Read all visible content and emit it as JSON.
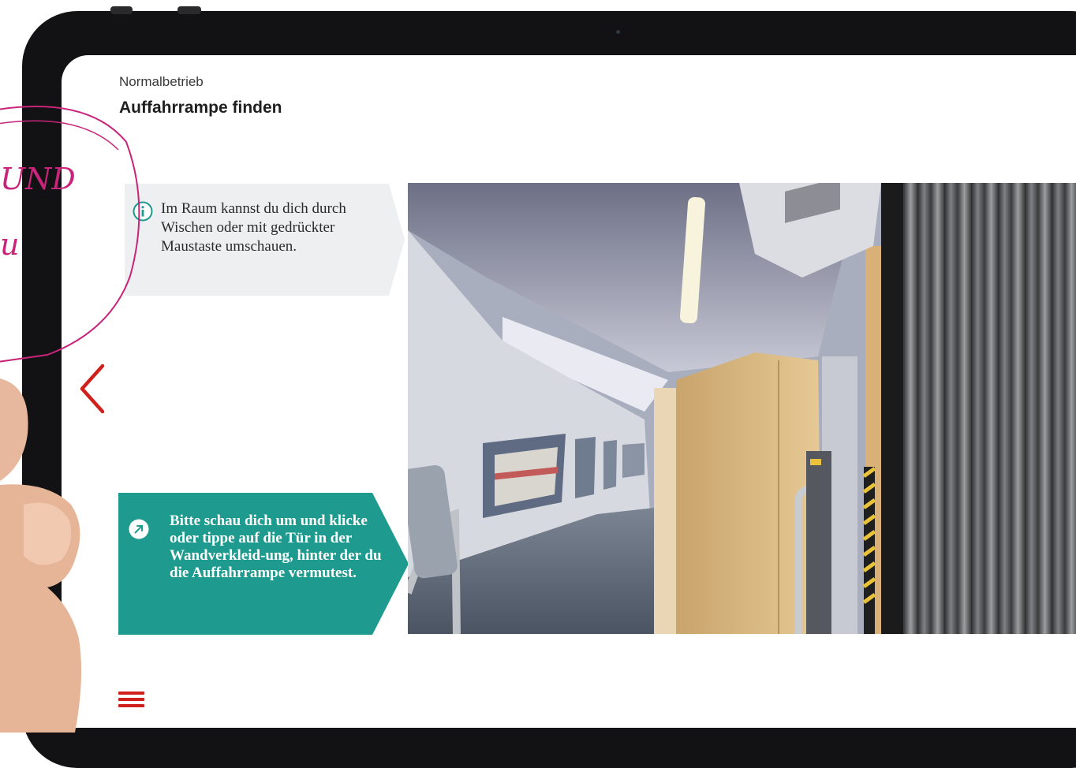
{
  "breadcrumb": "Normalbetrieb",
  "title": "Auffahrrampe finden",
  "info": {
    "icon": "info-circle-icon",
    "text": "Im Raum kannst du dich durch Wischen oder mit gedrückter Maustaste umschauen."
  },
  "task": {
    "icon": "arrow-up-right-icon",
    "text": "Bitte schau dich um und klicke oder tippe auf die Tür in der Wandverkleid-ung, hinter der du die Auffahrrampe vermutest."
  },
  "navigation": {
    "back_icon": "chevron-left-icon",
    "menu_icon": "hamburger-menu-icon"
  },
  "annotation": {
    "line1": "UND",
    "line2": "u"
  },
  "colors": {
    "accent_red": "#d0201c",
    "teal": "#1e9b8e",
    "info_bg": "#eeeff0",
    "annotation_pink": "#c8257a"
  }
}
